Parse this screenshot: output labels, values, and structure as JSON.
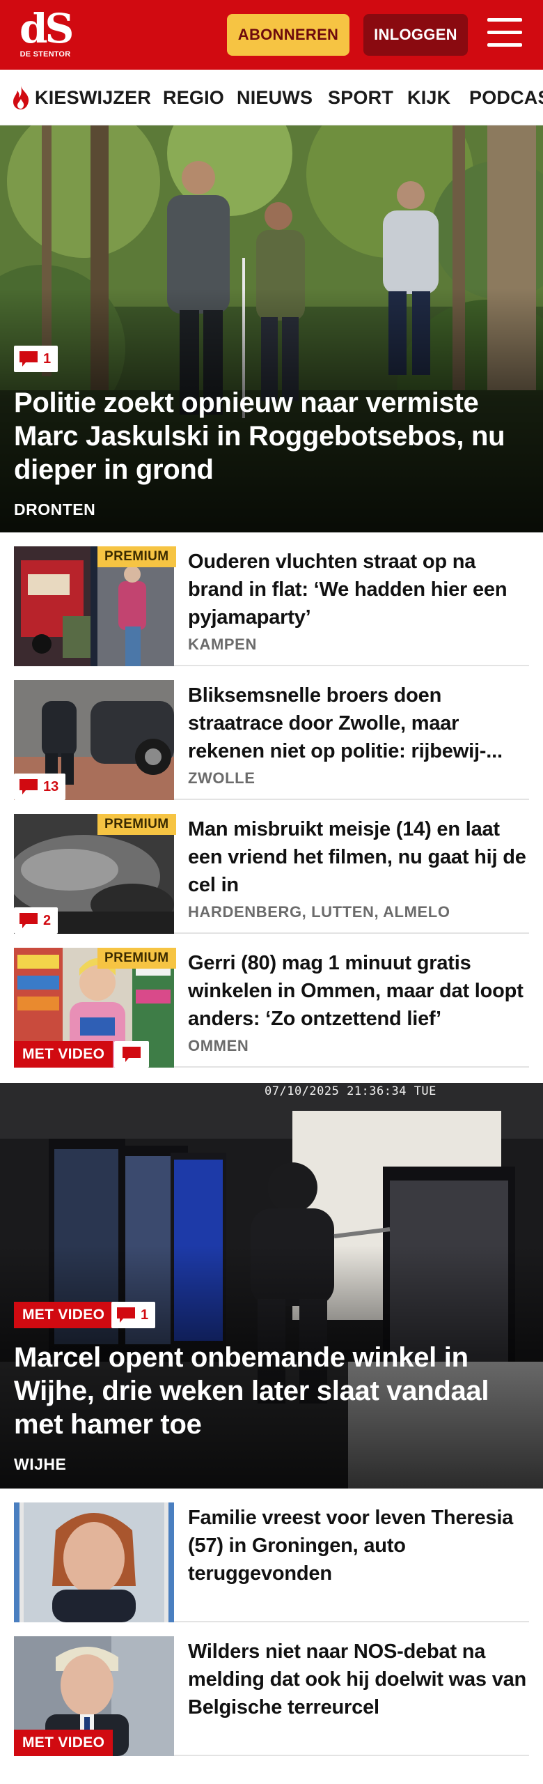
{
  "header": {
    "logo_mark": "dS",
    "logo_sub": "DE STENTOR",
    "subscribe_label": "ABONNEREN",
    "login_label": "INLOGGEN"
  },
  "nav": {
    "items": [
      "KIESWIJZER",
      "REGIO",
      "NIEUWS",
      "SPORT",
      "KIJK",
      "PODCAST"
    ]
  },
  "hero": {
    "comments": "1",
    "title": "Politie zoekt opnieuw naar vermiste Marc Jaskulski in Roggebotsebos, nu dieper in grond",
    "location": "DRONTEN"
  },
  "articles": [
    {
      "title": "Ouderen vluchten straat op na brand in flat: ‘We hadden hier een pyjamaparty’",
      "location": "KAMPEN",
      "premium": "PREMIUM"
    },
    {
      "title": "Bliksemsnelle broers doen straatrace door Zwolle, maar rekenen niet op politie: rijbewij-...",
      "location": "ZWOLLE",
      "comments": "13"
    },
    {
      "title": "Man misbruikt meisje (14) en laat een vriend het filmen, nu gaat hij de cel in",
      "location": "HARDENBERG, LUTTEN, ALMELO",
      "premium": "PREMIUM",
      "comments": "2"
    },
    {
      "title": "Gerri (80) mag 1 minuut gratis winkelen in Ommen, maar dat loopt anders: ‘Zo ontzettend lief’",
      "location": "OMMEN",
      "premium": "PREMIUM",
      "video": "MET VIDEO"
    }
  ],
  "hero2": {
    "timestamp": "07/10/2025 21:36:34 TUE",
    "video": "MET VIDEO",
    "comments": "1",
    "title": "Marcel opent onbemande winkel in Wijhe, drie weken later slaat vandaal met hamer toe",
    "location": "WIJHE"
  },
  "articles2": [
    {
      "title": "Familie vreest voor leven Theresia (57) in Groningen, auto teruggevonden"
    },
    {
      "title": "Wilders niet naar NOS-debat na melding dat ook hij doelwit was van Belgische terreurcel",
      "video": "MET VIDEO"
    }
  ],
  "colors": {
    "brand_red": "#d10a11",
    "subscribe_yellow": "#f6c443",
    "login_dark_red": "#8a0a10",
    "premium_yellow": "#f6c443"
  },
  "icons": [
    "flame-icon",
    "comment-bubble-icon",
    "menu-icon"
  ]
}
